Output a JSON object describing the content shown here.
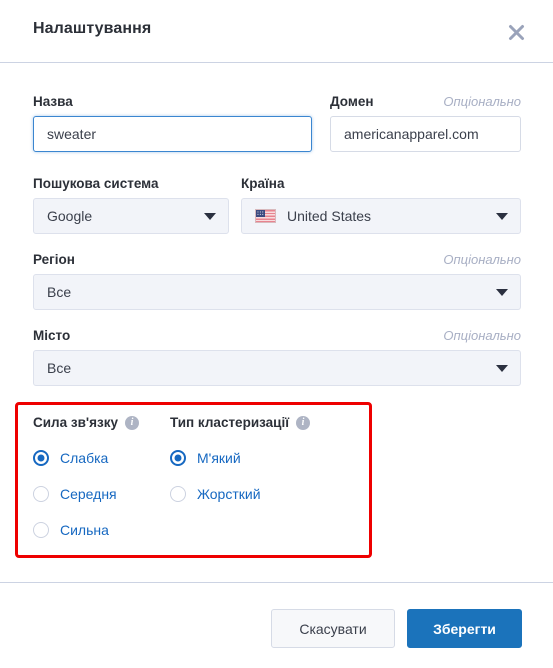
{
  "dialog": {
    "title": "Налаштування",
    "close_icon": "close-icon"
  },
  "fields": {
    "name": {
      "label": "Назва",
      "value": "sweater",
      "placeholder": ""
    },
    "domain": {
      "label": "Домен",
      "optional_tag": "Опціонально",
      "value": "americanapparel.com",
      "placeholder": ""
    },
    "search_engine": {
      "label": "Пошукова система",
      "value": "Google"
    },
    "country": {
      "label": "Країна",
      "value": "United States",
      "flag_icon": "us-flag-icon"
    },
    "region": {
      "label": "Регіон",
      "optional_tag": "Опціонально",
      "value": "Все"
    },
    "city": {
      "label": "Місто",
      "optional_tag": "Опціонально",
      "value": "Все"
    }
  },
  "radio_section": {
    "highlight_color": "#ee0000",
    "link_strength": {
      "title": "Сила зв'язку",
      "info_icon": "info-icon",
      "options": [
        {
          "label": "Слабка",
          "checked": true
        },
        {
          "label": "Середня",
          "checked": false
        },
        {
          "label": "Сильна",
          "checked": false
        }
      ]
    },
    "cluster_type": {
      "title": "Тип кластеризації",
      "info_icon": "info-icon",
      "options": [
        {
          "label": "М'який",
          "checked": true
        },
        {
          "label": "Жорсткий",
          "checked": false
        }
      ]
    }
  },
  "footer": {
    "cancel_label": "Скасувати",
    "save_label": "Зберегти",
    "save_color": "#1b73bb"
  }
}
